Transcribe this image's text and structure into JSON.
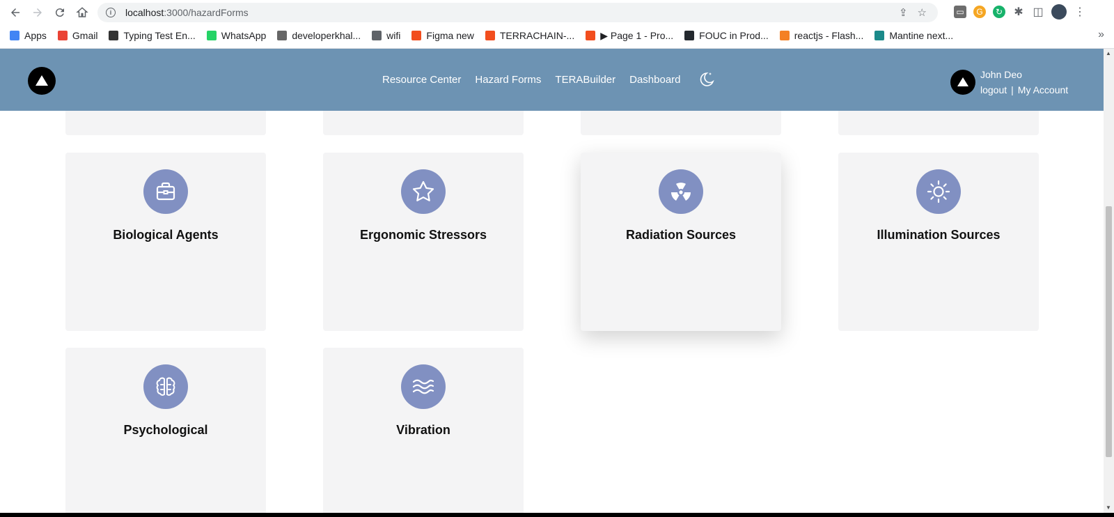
{
  "browser": {
    "url_host": "localhost",
    "url_path": ":3000/hazardForms",
    "bookmarks": [
      {
        "label": "Apps",
        "icon": "apps-grid-icon",
        "color": "#4285f4"
      },
      {
        "label": "Gmail",
        "icon": "gmail-icon",
        "color": "#ea4335"
      },
      {
        "label": "Typing Test En...",
        "icon": "typing-test-icon",
        "color": "#333333"
      },
      {
        "label": "WhatsApp",
        "icon": "whatsapp-icon",
        "color": "#25d366"
      },
      {
        "label": "developerkhal...",
        "icon": "dev-icon",
        "color": "#666666"
      },
      {
        "label": "wifi",
        "icon": "globe-icon",
        "color": "#5f6368"
      },
      {
        "label": "Figma new",
        "icon": "figma-icon",
        "color": "#f24e1e"
      },
      {
        "label": "TERRACHAIN-...",
        "icon": "figma-icon",
        "color": "#f24e1e"
      },
      {
        "label": "▶ Page 1 - Pro...",
        "icon": "figma-icon",
        "color": "#f24e1e"
      },
      {
        "label": "FOUC in Prod...",
        "icon": "github-icon",
        "color": "#24292e"
      },
      {
        "label": "reactjs - Flash...",
        "icon": "stackoverflow-icon",
        "color": "#f48024"
      },
      {
        "label": "Mantine next...",
        "icon": "react-icon",
        "color": "#1b8a8a"
      }
    ]
  },
  "header": {
    "nav": [
      "Resource Center",
      "Hazard Forms",
      "TERABuilder",
      "Dashboard"
    ],
    "user_name": "John Deo",
    "logout": "logout",
    "separator": "|",
    "account": "My Account",
    "color": "#6d93b3"
  },
  "cards": [
    {
      "title": "Biological Agents",
      "icon": "briefcase-icon"
    },
    {
      "title": "Ergonomic Stressors",
      "icon": "star-icon"
    },
    {
      "title": "Radiation Sources",
      "icon": "radiation-icon"
    },
    {
      "title": "Illumination Sources",
      "icon": "sun-icon"
    },
    {
      "title": "Psychological",
      "icon": "brain-icon"
    },
    {
      "title": "Vibration",
      "icon": "waves-icon"
    }
  ],
  "accent": "#8190c2"
}
